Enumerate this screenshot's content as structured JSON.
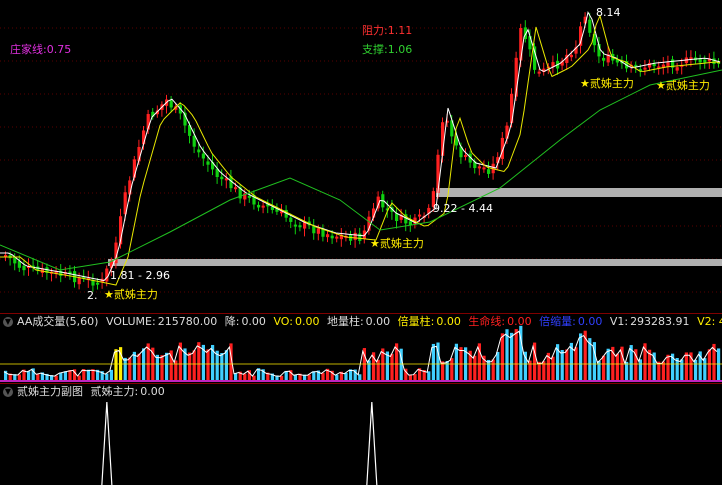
{
  "main_chart": {
    "zhuangjia_label": "庄家线:0.75",
    "resistance_label": "阻力:1.11",
    "support_label": "支撑:1.06",
    "high_marker": "8.14",
    "level_labels": [
      "1.81 - 2.96",
      "9.22 - 4.44"
    ],
    "low_marker": "2.",
    "signal_label": "贰姊主力",
    "colors": {
      "up": "#ff2020",
      "down": "#10d010",
      "ma_fast": "#ffffff",
      "ma_mid": "#e8e800",
      "ma_slow": "#20c020",
      "band": "#b0b0b0",
      "marker": "#ffee00"
    }
  },
  "volume_panel": {
    "toggle_icon": "chevron-down-icon",
    "title": "AA成交量(5,60)",
    "volume_label": "VOLUME:",
    "volume_value": "215780.00",
    "jiang_label": "降:",
    "jiang_value": "0.00",
    "vo_label": "VO:",
    "vo_value": "0.00",
    "diliangzhu_label": "地量柱:",
    "diliangzhu_value": "0.00",
    "beiliangzhu_label": "倍量柱:",
    "beiliangzhu_value": "0.00",
    "shengmingxian_label": "生命线:",
    "shengmingxian_value": "0.00",
    "beisuoliang_label": "倍缩量:",
    "beisuoliang_value": "0.00",
    "v1_label": "V1:",
    "v1_value": "293283.91",
    "v2_label": "V2: 4",
    "colors": {
      "bar_up": "#ff2020",
      "bar_down": "#40d0ff",
      "bar_special": "#ffee00",
      "line": "#ffffff"
    }
  },
  "sub_panel": {
    "toggle_icon": "chevron-down-icon",
    "title": "贰姊主力副图",
    "value_label": "贰姊主力:",
    "value": "0.00",
    "spike_positions": [
      0.148,
      0.515
    ],
    "colors": {
      "spike": "#ffffff"
    }
  }
}
